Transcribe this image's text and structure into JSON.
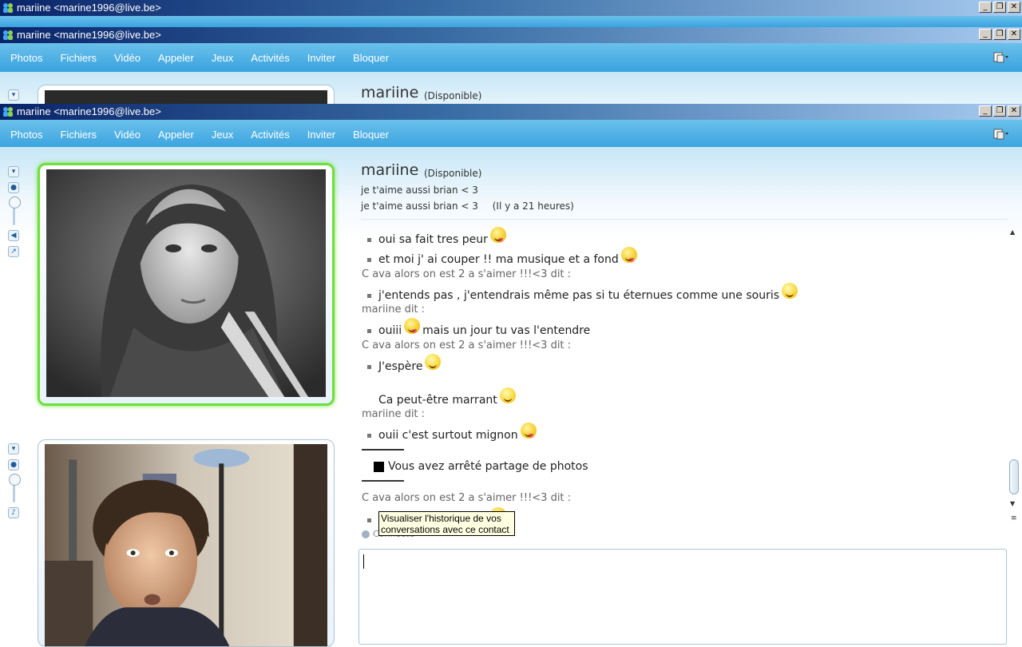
{
  "windows": [
    {
      "title": "mariine <marine1996@live.be>"
    },
    {
      "title": "mariine <marine1996@live.be>"
    },
    {
      "title": "mariine <marine1996@live.be>"
    }
  ],
  "window_buttons": {
    "minimize": "_",
    "restore": "❐",
    "close": "✕"
  },
  "menu": [
    "Photos",
    "Fichiers",
    "Vidéo",
    "Appeler",
    "Jeux",
    "Activités",
    "Inviter",
    "Bloquer"
  ],
  "contact": {
    "name": "mariine",
    "status": "(Disponible)",
    "psm": "je t'aime aussi brian < 3",
    "last_message": "je t'aime aussi brian < 3",
    "last_time": "(Il y a 21 heures)"
  },
  "conversation": [
    {
      "type": "message",
      "text": "oui sa fait tres peur",
      "emoticon": "tongue"
    },
    {
      "type": "message",
      "text": "et moi  j' ai couper !!  ma musique et a fond",
      "emoticon": "tongue"
    },
    {
      "type": "sender",
      "text": "C ava alors on est 2 a s'aimer !!!<3 dit :"
    },
    {
      "type": "message",
      "text": "j'entends pas , j'entendrais même pas si tu éternues comme une souris",
      "emoticon": "happy"
    },
    {
      "type": "sender",
      "text": "mariine dit :"
    },
    {
      "type": "message",
      "text": "ouiii",
      "emoticon": "tongue",
      "after": "mais un jour tu vas l'entendre"
    },
    {
      "type": "sender",
      "text": "C ava alors on est 2 a s'aimer !!!<3 dit :"
    },
    {
      "type": "message",
      "text": "J'espère",
      "emoticon": "happy"
    },
    {
      "type": "continuation",
      "text": "Ca peut-être marrant",
      "emoticon": "happy"
    },
    {
      "type": "sender",
      "text": "mariine dit :"
    },
    {
      "type": "message",
      "text": "ouii c'est surtout mignon",
      "emoticon": "tongue"
    },
    {
      "type": "notice",
      "text": "Vous avez arrêté partage de photos"
    },
    {
      "type": "sender",
      "text": "C ava alors on est 2 a s'aimer !!!<3 dit :"
    }
  ],
  "tooltip": {
    "line1": "Visualiser l'historique de vos",
    "line2": "conversations avec ce contact"
  },
  "connection_status": "Connecté",
  "icons": [
    "msn-buddy-icon",
    "webcam-icon",
    "speaker-icon",
    "microphone-icon",
    "expand-icon",
    "history-icon"
  ],
  "colors": {
    "menubar": "#39a3df",
    "webcam_frame_active": "#6fde3f",
    "titlebar_start": "#0a246a"
  }
}
